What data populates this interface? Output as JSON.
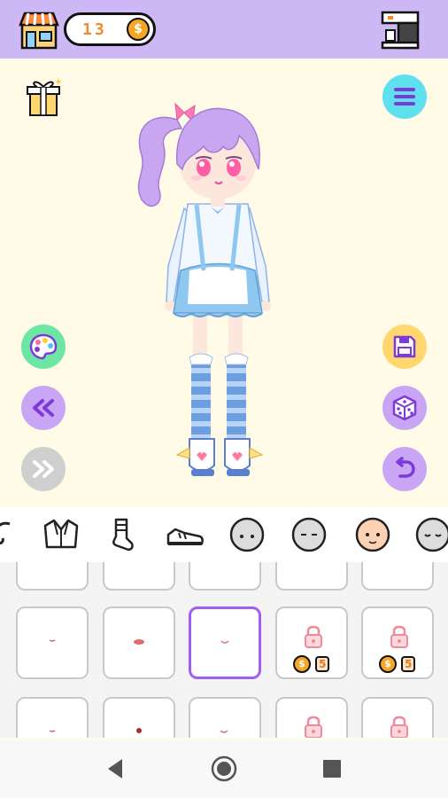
{
  "topbar": {
    "coins": "13",
    "coin_symbol": "$"
  },
  "colors": {
    "topbar": "#cdb7f5",
    "stage": "#fffbe6",
    "selected_border": "#a35df0",
    "coin": "#f6a623"
  },
  "side_buttons": {
    "left": [
      "palette-icon",
      "rewind-icon",
      "fast-forward-icon"
    ],
    "right": [
      "menu-icon",
      "save-icon",
      "dice-icon",
      "undo-icon"
    ]
  },
  "category_tabs": [
    "hair",
    "jacket",
    "sock",
    "shoe",
    "face-base",
    "face-base-2",
    "skin-face",
    "face-base-3"
  ],
  "items": {
    "row1": [
      {
        "type": "mouth",
        "locked": false
      },
      {
        "type": "mouth",
        "locked": false
      },
      {
        "type": "mouth",
        "locked": false,
        "selected": true
      },
      {
        "type": "mouth",
        "locked": true,
        "price_symbol": "$",
        "price": "5"
      },
      {
        "type": "mouth",
        "locked": true,
        "price_symbol": "$",
        "price": "5"
      }
    ]
  },
  "nav": [
    "back-icon",
    "home-icon",
    "recents-icon"
  ]
}
